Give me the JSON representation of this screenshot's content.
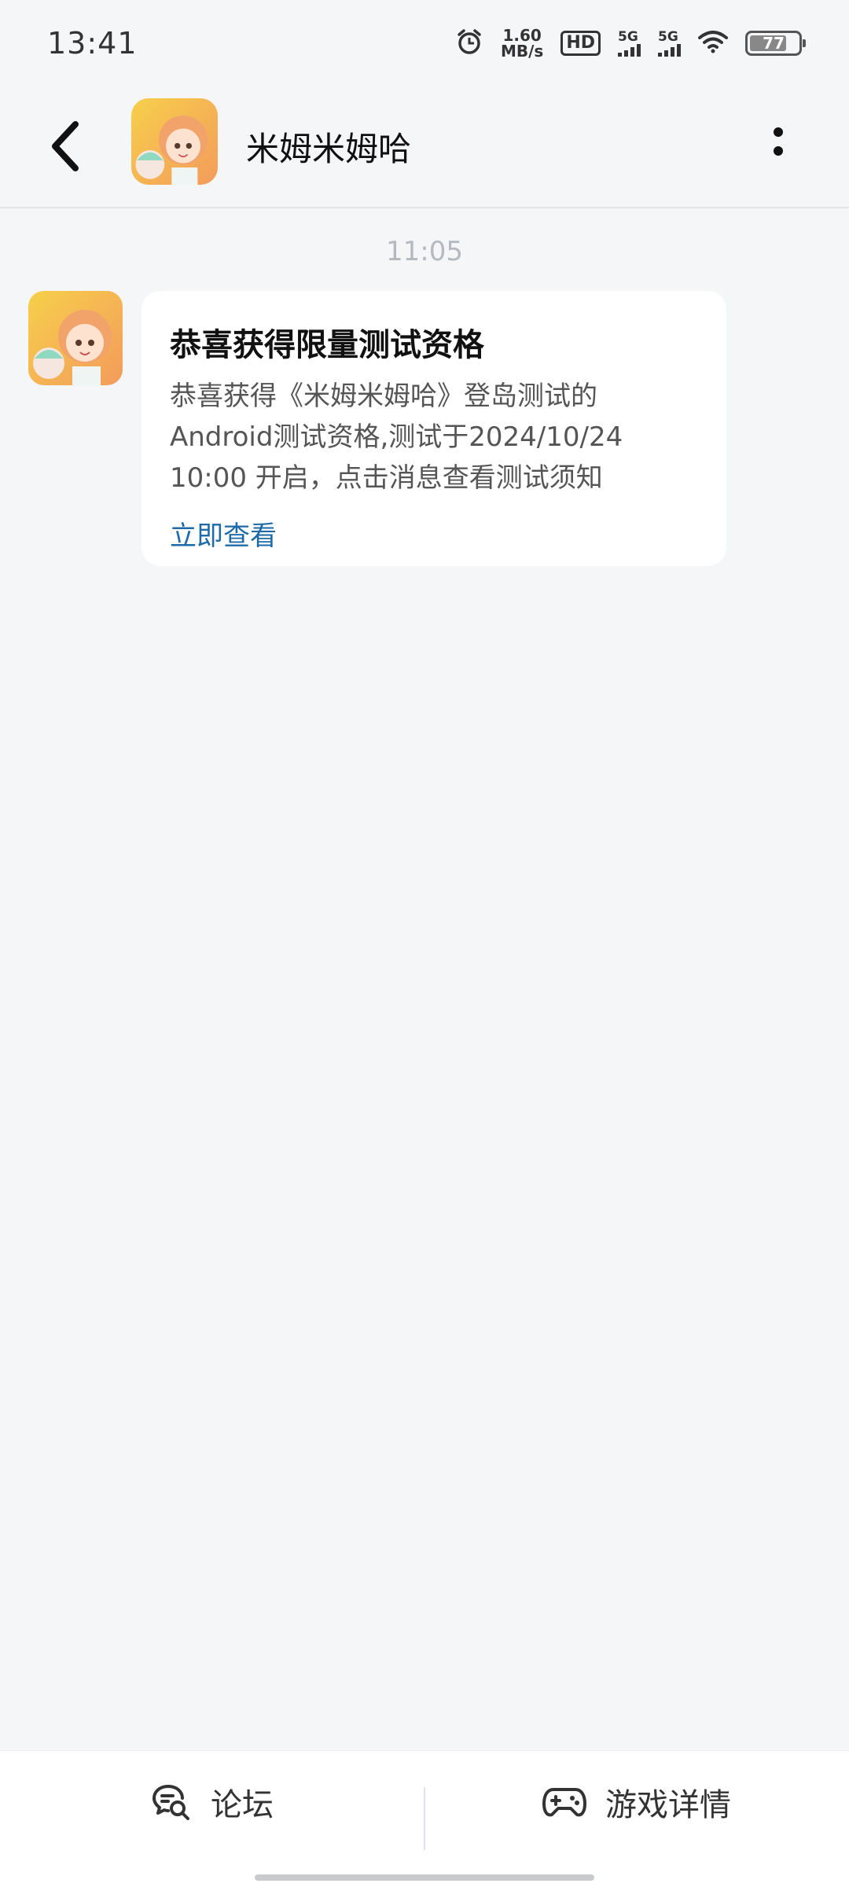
{
  "status_bar": {
    "time": "13:41",
    "net_speed_value": "1.60",
    "net_speed_unit": "MB/s",
    "hd_label": "HD",
    "sim1_label": "5G",
    "sim2_label": "5G",
    "battery_level": "77",
    "battery_fraction": 0.77,
    "icons": [
      "alarm-icon",
      "hd-icon",
      "signal-icon",
      "signal-icon",
      "wifi-icon",
      "battery-icon"
    ]
  },
  "header": {
    "title": "米姆米姆哈",
    "back_icon": "chevron-left-icon",
    "more_icon": "more-vertical-icon"
  },
  "chat": {
    "timestamp": "11:05",
    "message": {
      "title": "恭喜获得限量测试资格",
      "body": "恭喜获得《米姆米姆哈》登岛测试的Android测试资格,测试于2024/10/24 10:00 开启，点击消息查看测试须知",
      "link_label": "立即查看"
    }
  },
  "bottom_bar": {
    "forum_label": "论坛",
    "forum_icon": "chat-search-icon",
    "details_label": "游戏详情",
    "details_icon": "gamepad-icon"
  },
  "colors": {
    "background": "#f5f6f8",
    "link": "#1e6aa8",
    "timestamp": "#b4b8bf"
  }
}
